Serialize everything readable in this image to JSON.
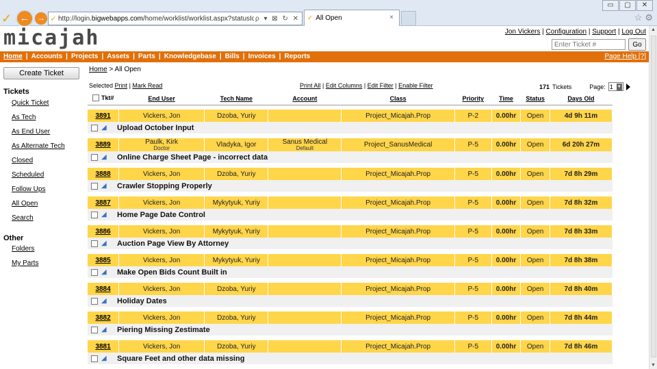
{
  "browser": {
    "url_prefix": "http://login.",
    "url_domain": "bigwebapps.com",
    "url_rest": "/home/worklist/worklist.aspx?statusId=allopen",
    "addr_tools": "ρ ▾ ⊠ ↻ ✕",
    "tab_title": "All Open",
    "tab_close": "×",
    "favicon": "✓",
    "window_controls": [
      "▭",
      "▢",
      "✕"
    ]
  },
  "header": {
    "logo": "micajah",
    "user_name": "Jon Vickers",
    "links": [
      "Configuration",
      "Support",
      "Log Out"
    ],
    "ticket_placeholder": "Enter Ticket #",
    "go_label": "Go"
  },
  "nav": {
    "items": [
      "Home",
      "Accounts",
      "Projects",
      "Assets",
      "Parts",
      "Knowledgebase",
      "Bills",
      "Invoices",
      "Reports"
    ],
    "help": "Page Help [?]"
  },
  "sidebar": {
    "create_label": "Create Ticket",
    "tickets_heading": "Tickets",
    "ticket_links": [
      "Quick Ticket",
      "As Tech",
      "As End User",
      "As Alternate Tech",
      "Closed",
      "Scheduled",
      "Follow Ups",
      "All Open",
      "Search"
    ],
    "other_heading": "Other",
    "other_links": [
      "Folders",
      "My Parts"
    ]
  },
  "main": {
    "breadcrumb_home": "Home",
    "breadcrumb_sep": ">",
    "breadcrumb_current": "All Open",
    "selected_label": "Selected",
    "print_label": "Print",
    "mark_read_label": "Mark Read",
    "print_all": "Print All",
    "edit_columns": "Edit Columns",
    "edit_filter": "Edit Filter",
    "enable_filter": "Enable Filter",
    "ticket_count": "171",
    "tickets_label": "Tickets",
    "page_label": "Page:",
    "page_value": "1"
  },
  "table": {
    "columns": [
      "Tkt#",
      "End User",
      "Tech Name",
      "Account",
      "Class",
      "Priority",
      "Time",
      "Status",
      "Days Old"
    ],
    "rows": [
      {
        "tkt": "3891",
        "end_user": "Vickers, Jon",
        "end_user_sub": "",
        "tech": "Dzoba, Yuriy",
        "account": "",
        "account_sub": "",
        "class": "Project_Micajah.Prop",
        "priority": "P-2",
        "time": "0.00hr",
        "status": "Open",
        "days": "4d 9h 11m",
        "subject": "Upload October Input"
      },
      {
        "tkt": "3889",
        "end_user": "Paulk, Kirk",
        "end_user_sub": "Doctor",
        "tech": "Vladyka, Igor",
        "account": "Sanus Medical",
        "account_sub": "Default",
        "class": "Project_SanusMedical",
        "priority": "P-5",
        "time": "0.00hr",
        "status": "Open",
        "days": "6d 20h 27m",
        "subject": "Online Charge Sheet Page - incorrect data"
      },
      {
        "tkt": "3888",
        "end_user": "Vickers, Jon",
        "end_user_sub": "",
        "tech": "Dzoba, Yuriy",
        "account": "",
        "account_sub": "",
        "class": "Project_Micajah.Prop",
        "priority": "P-5",
        "time": "0.00hr",
        "status": "Open",
        "days": "7d 8h 29m",
        "subject": "Crawler Stopping Properly"
      },
      {
        "tkt": "3887",
        "end_user": "Vickers, Jon",
        "end_user_sub": "",
        "tech": "Mykytyuk, Yuriy",
        "account": "",
        "account_sub": "",
        "class": "Project_Micajah.Prop",
        "priority": "P-5",
        "time": "0.00hr",
        "status": "Open",
        "days": "7d 8h 32m",
        "subject": "Home Page Date Control"
      },
      {
        "tkt": "3886",
        "end_user": "Vickers, Jon",
        "end_user_sub": "",
        "tech": "Mykytyuk, Yuriy",
        "account": "",
        "account_sub": "",
        "class": "Project_Micajah.Prop",
        "priority": "P-5",
        "time": "0.00hr",
        "status": "Open",
        "days": "7d 8h 33m",
        "subject": "Auction Page View By Attorney"
      },
      {
        "tkt": "3885",
        "end_user": "Vickers, Jon",
        "end_user_sub": "",
        "tech": "Mykytyuk, Yuriy",
        "account": "",
        "account_sub": "",
        "class": "Project_Micajah.Prop",
        "priority": "P-5",
        "time": "0.00hr",
        "status": "Open",
        "days": "7d 8h 38m",
        "subject": "Make Open Bids Count Built in"
      },
      {
        "tkt": "3884",
        "end_user": "Vickers, Jon",
        "end_user_sub": "",
        "tech": "Dzoba, Yuriy",
        "account": "",
        "account_sub": "",
        "class": "Project_Micajah.Prop",
        "priority": "P-5",
        "time": "0.00hr",
        "status": "Open",
        "days": "7d 8h 40m",
        "subject": "Holiday Dates"
      },
      {
        "tkt": "3882",
        "end_user": "Vickers, Jon",
        "end_user_sub": "",
        "tech": "Dzoba, Yuriy",
        "account": "",
        "account_sub": "",
        "class": "Project_Micajah.Prop",
        "priority": "P-5",
        "time": "0.00hr",
        "status": "Open",
        "days": "7d 8h 44m",
        "subject": "Piering Missing Zestimate"
      },
      {
        "tkt": "3881",
        "end_user": "Vickers, Jon",
        "end_user_sub": "",
        "tech": "Dzoba, Yuriy",
        "account": "",
        "account_sub": "",
        "class": "Project_Micajah.Prop",
        "priority": "P-5",
        "time": "0.00hr",
        "status": "Open",
        "days": "7d 8h 46m",
        "subject": "Square Feet and other data missing"
      }
    ]
  },
  "colors": {
    "nav_orange": "#e0700b",
    "row_yellow": "#ffd54a",
    "row_sub_gray": "#f0f0f0"
  }
}
